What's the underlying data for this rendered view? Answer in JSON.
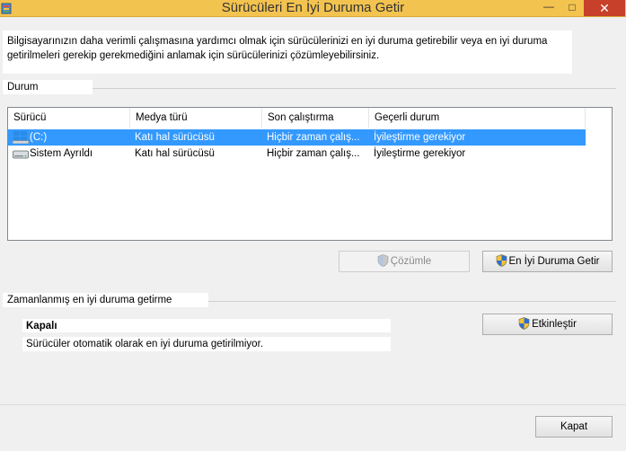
{
  "window": {
    "title": "Sürücüleri En İyi Duruma Getir",
    "minimize_glyph": "—",
    "maximize_glyph": "□",
    "close_glyph": "✕"
  },
  "intro_text": "Bilgisayarınızın daha verimli çalışmasına yardımcı olmak için sürücülerinizi en iyi duruma getirebilir veya en iyi duruma getirilmeleri gerekip gerekmediğini anlamak için sürücülerinizi çözümleyebilirsiniz.",
  "status_section": {
    "label": "Durum",
    "columns": [
      "Sürücü",
      "Medya türü",
      "Son çalıştırma",
      "Geçerli durum"
    ],
    "rows": [
      {
        "drive": "(C:)",
        "icon": "windows-drive-icon",
        "media": "Katı hal sürücüsü",
        "last_run": "Hiçbir zaman çalış...",
        "status": "İyileştirme gerekiyor",
        "selected": true
      },
      {
        "drive": "Sistem Ayrıldı",
        "icon": "hard-drive-icon",
        "media": "Katı hal sürücüsü",
        "last_run": "Hiçbir zaman çalış...",
        "status": "İyileştirme gerekiyor",
        "selected": false
      }
    ],
    "analyze_label": "Çözümle",
    "optimize_label": "En İyi Duruma Getir"
  },
  "scheduled_section": {
    "label": "Zamanlanmış en iyi duruma getirme",
    "state": "Kapalı",
    "description": "Sürücüler otomatik olarak en iyi duruma getirilmiyor.",
    "enable_label": "Etkinleştir"
  },
  "footer": {
    "close_label": "Kapat"
  },
  "colors": {
    "titlebar": "#f3c34f",
    "close_button": "#c7402a",
    "selection": "#3399ff"
  }
}
